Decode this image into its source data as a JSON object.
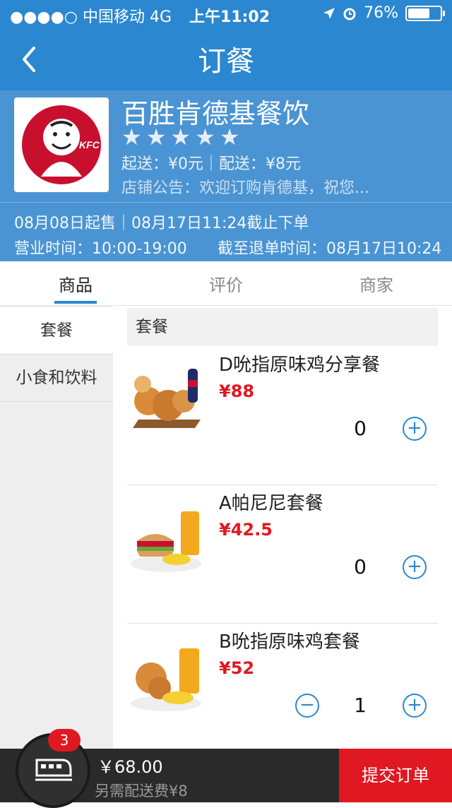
{
  "status_bar": {
    "carrier": "●●●●○ 中国移动   4G",
    "time": "上午11:02",
    "battery_text": "76%",
    "battery_level": 0.76
  },
  "nav": {
    "title": "订餐",
    "back_icon": "chevron-left-icon"
  },
  "store": {
    "name": "百胜肯德基餐饮",
    "rating": 5,
    "star_glyph": "★",
    "delivery": "起送：¥0元｜配送：¥8元",
    "notice": "店铺公告：欢迎订购肯德基，祝您...",
    "sale_period": "08月08日起售｜08月17日11:24截止下单",
    "business_hours": "营业时间：10:00-19:00",
    "cancel_deadline": "截至退单时间：08月17日10:24",
    "logo_text": "KFC"
  },
  "tabs": [
    {
      "label": "商品",
      "active": true
    },
    {
      "label": "评价",
      "active": false
    },
    {
      "label": "商家",
      "active": false
    }
  ],
  "categories": [
    {
      "label": "套餐",
      "active": true
    },
    {
      "label": "小食和饮料",
      "active": false
    }
  ],
  "section_title": "套餐",
  "items": [
    {
      "name": "D吮指原味鸡分享餐",
      "price": "¥88",
      "qty": "0"
    },
    {
      "name": "A帕尼尼套餐",
      "price": "¥42.5",
      "qty": "0"
    },
    {
      "name": "B吮指原味鸡套餐",
      "price": "¥52",
      "qty": "1"
    }
  ],
  "cart": {
    "badge": "3",
    "total": "￥68.00",
    "extra_fee": "另需配送费¥8",
    "submit_label": "提交订单",
    "icon": "train-cart-icon"
  },
  "colors": {
    "primary": "#2b87cf",
    "accent": "#e01822"
  }
}
